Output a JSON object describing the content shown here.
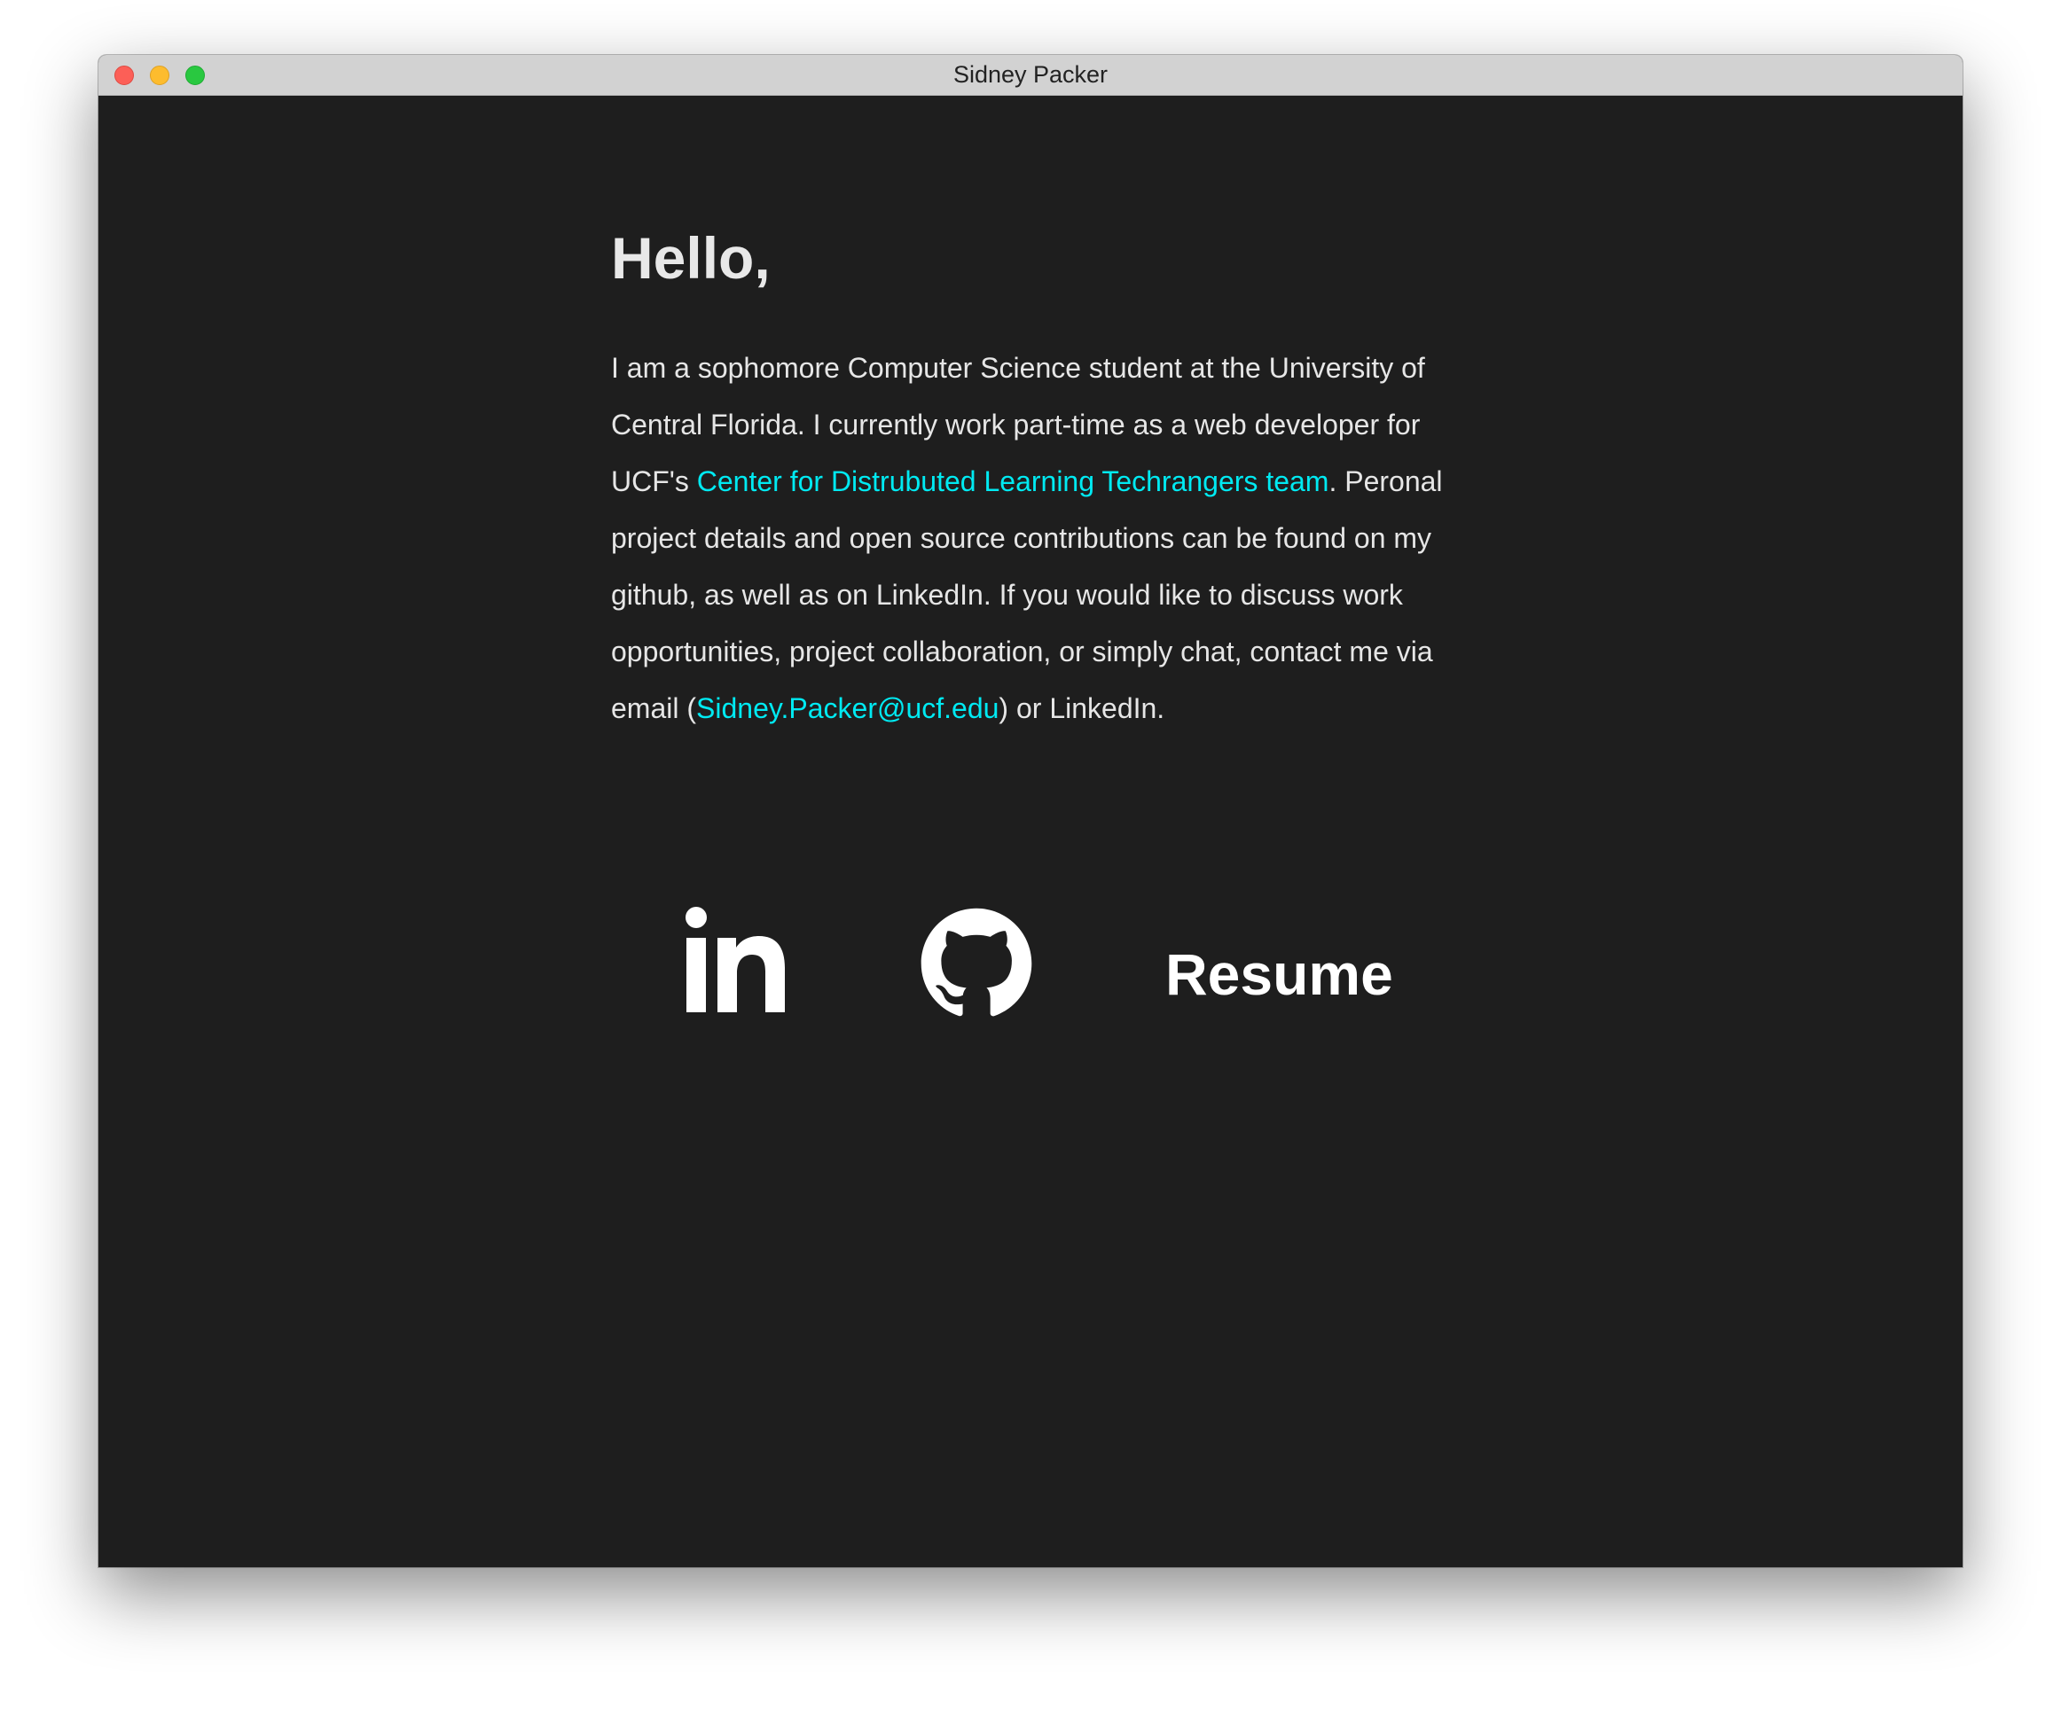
{
  "window": {
    "title": "Sidney Packer"
  },
  "main": {
    "greeting": "Hello,",
    "bio": {
      "part1": "I am a sophomore Computer Science student at the University of Central Florida. I currently work part-time as a web developer for UCF's ",
      "team_link": "Center for Distrubuted Learning Techrangers team",
      "part2": ". Peronal project details and open source contributions can be found on my github, as well as on LinkedIn. If you would like to discuss work opportunities, project collaboration, or simply chat, contact me via email (",
      "email_link": "Sidney.Packer@ucf.edu",
      "part3": ") or LinkedIn."
    }
  },
  "links": {
    "linkedin_icon": "linkedin-icon",
    "github_icon": "github-icon",
    "resume_label": "Resume"
  },
  "colors": {
    "background": "#1e1e1e",
    "text": "#e6e6e6",
    "link": "#00eaf2",
    "titlebar": "#d2d2d2"
  }
}
